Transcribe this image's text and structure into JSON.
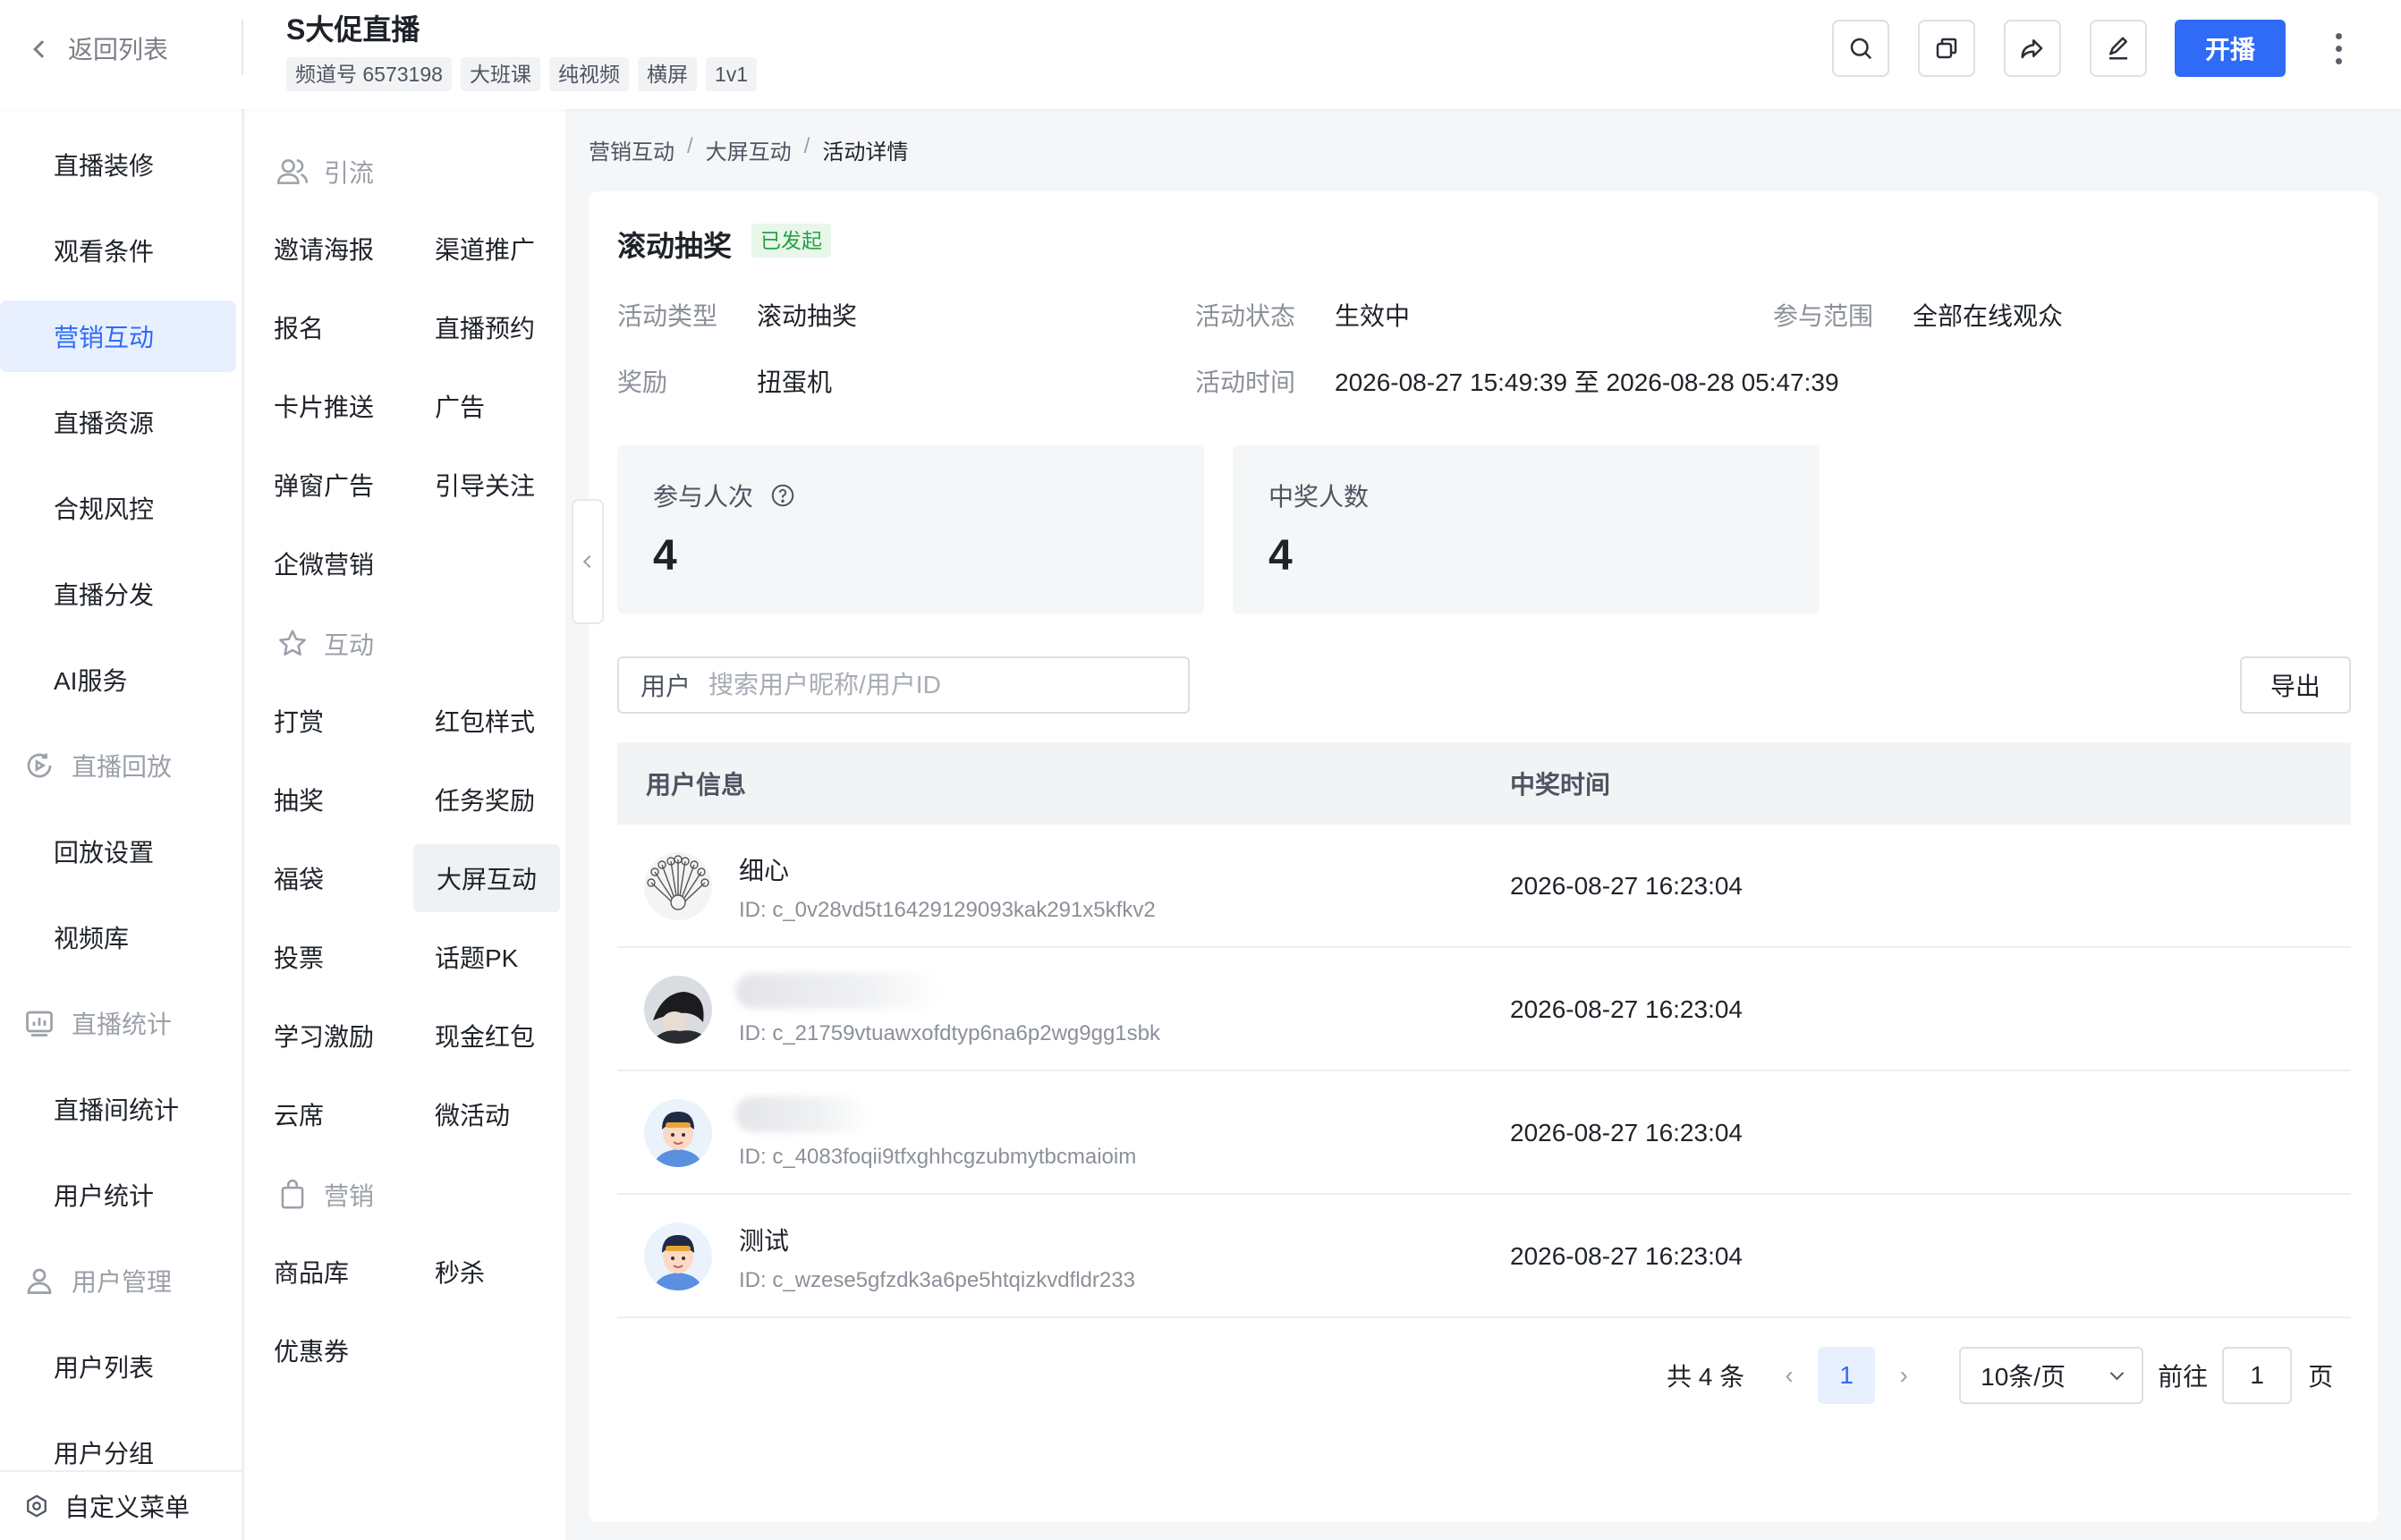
{
  "header": {
    "back_label": "返回列表",
    "title": "S大促直播",
    "tags": [
      "频道号 6573198",
      "大班课",
      "纯视频",
      "横屏",
      "1v1"
    ],
    "start_label": "开播",
    "icons": [
      "search-icon",
      "copy-icon",
      "share-icon",
      "edit-icon",
      "more-icon"
    ]
  },
  "sidebar": {
    "items": [
      {
        "label": "直播装修",
        "type": "item"
      },
      {
        "label": "观看条件",
        "type": "item"
      },
      {
        "label": "营销互动",
        "type": "item",
        "active": true
      },
      {
        "label": "直播资源",
        "type": "item"
      },
      {
        "label": "合规风控",
        "type": "item"
      },
      {
        "label": "直播分发",
        "type": "item"
      },
      {
        "label": "AI服务",
        "type": "item"
      },
      {
        "label": "直播回放",
        "type": "group",
        "icon": "playback-icon"
      },
      {
        "label": "回放设置",
        "type": "item"
      },
      {
        "label": "视频库",
        "type": "item"
      },
      {
        "label": "直播统计",
        "type": "group",
        "icon": "stats-icon"
      },
      {
        "label": "直播间统计",
        "type": "item"
      },
      {
        "label": "用户统计",
        "type": "item"
      },
      {
        "label": "用户管理",
        "type": "group",
        "icon": "user-icon"
      },
      {
        "label": "用户列表",
        "type": "item"
      },
      {
        "label": "用户分组",
        "type": "item"
      }
    ],
    "footer_label": "自定义菜单"
  },
  "submenu": {
    "groups": [
      {
        "label": "引流",
        "icon": "users-icon"
      },
      {
        "label": "互动",
        "icon": "star-icon"
      },
      {
        "label": "营销",
        "icon": "bag-icon"
      }
    ],
    "items": [
      "邀请海报",
      "渠道推广",
      "报名",
      "直播预约",
      "卡片推送",
      "广告",
      "弹窗广告",
      "引导关注",
      "企微营销",
      "打赏",
      "红包样式",
      "抽奖",
      "任务奖励",
      "福袋",
      "大屏互动",
      "投票",
      "话题PK",
      "学习激励",
      "现金红包",
      "云席",
      "微活动",
      "商品库",
      "秒杀",
      "优惠券"
    ],
    "active": "大屏互动"
  },
  "breadcrumb": [
    "营销互动",
    "大屏互动",
    "活动详情"
  ],
  "activity": {
    "title": "滚动抽奖",
    "status_badge": "已发起",
    "fields": [
      {
        "label": "活动类型",
        "value": "滚动抽奖"
      },
      {
        "label": "活动状态",
        "value": "生效中"
      },
      {
        "label": "参与范围",
        "value": "全部在线观众"
      },
      {
        "label": "奖励",
        "value": "扭蛋机"
      },
      {
        "label": "活动时间",
        "value": "2026-08-27 15:49:39 至 2026-08-28 05:47:39"
      }
    ],
    "stats": [
      {
        "label": "参与人次",
        "value": "4",
        "help": true
      },
      {
        "label": "中奖人数",
        "value": "4"
      }
    ]
  },
  "search": {
    "prefix": "用户",
    "placeholder": "搜索用户昵称/用户ID",
    "value": ""
  },
  "export_label": "导出",
  "table": {
    "columns": [
      "用户信息",
      "中奖时间"
    ],
    "rows": [
      {
        "name": "细心",
        "id": "ID: c_0v28vd5t16429129093kak291x5kfkv2",
        "time": "2026-08-27 16:23:04",
        "avatar": "sketch"
      },
      {
        "name": "",
        "id": "ID: c_21759vtuawxofdtyp6na6p2wg9gg1sbk",
        "time": "2026-08-27 16:23:04",
        "avatar": "photo"
      },
      {
        "name": "",
        "id": "ID: c_4083foqii9tfxghhcgzubmytbcmaioim",
        "time": "2026-08-27 16:23:04",
        "avatar": "cartoon"
      },
      {
        "name": "测试",
        "id": "ID: c_wzese5gfzdk3a6pe5htqizkvdfldr233",
        "time": "2026-08-27 16:23:04",
        "avatar": "cartoon"
      }
    ]
  },
  "pagination": {
    "total_label": "共 4 条",
    "current_page": "1",
    "page_size": "10条/页",
    "goto_label": "前往",
    "goto_value": "1",
    "page_suffix": "页"
  },
  "colors": {
    "primary": "#2f6bf6",
    "success": "#25a244",
    "active_bg": "#e8efff"
  }
}
